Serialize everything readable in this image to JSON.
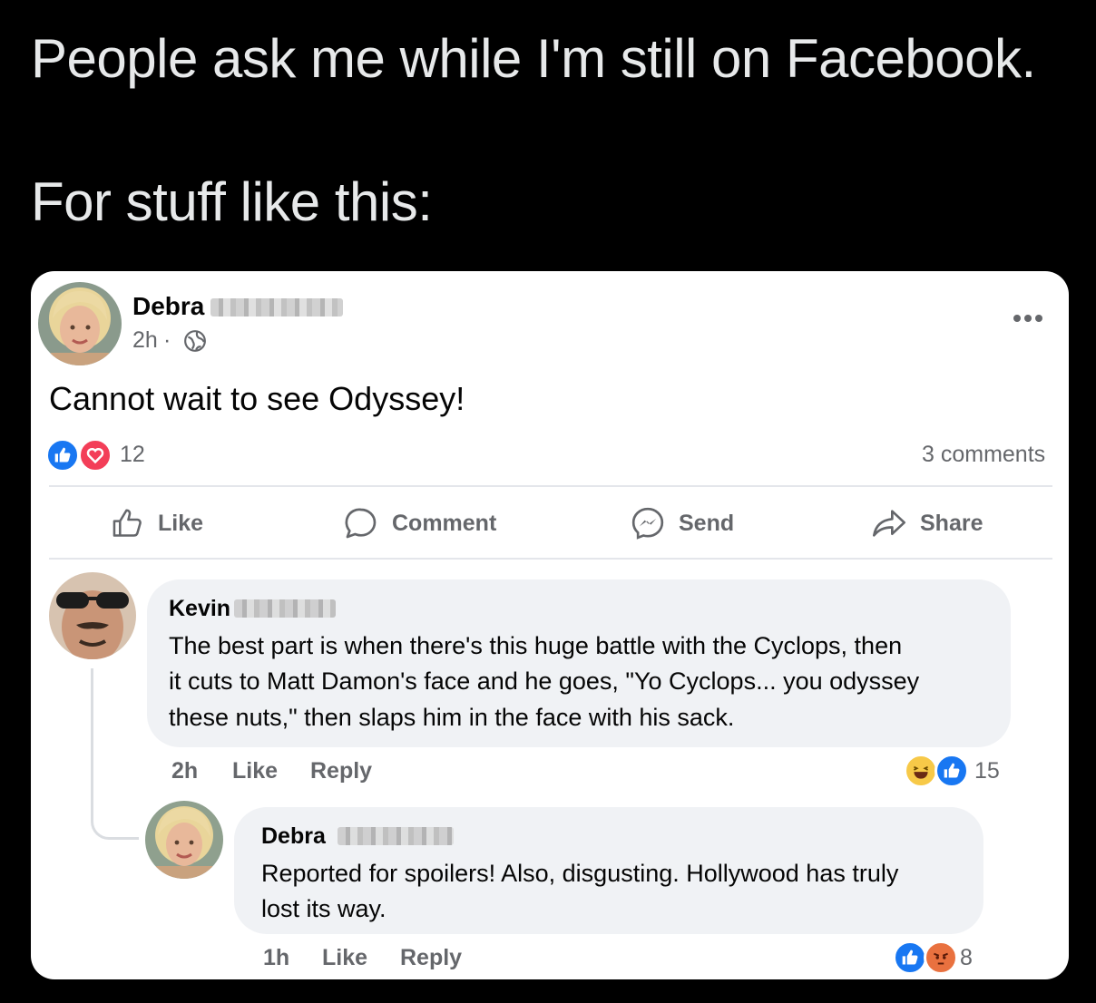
{
  "tweet": {
    "line1": "People ask me while I'm still on Facebook.",
    "line2": "For stuff like this:"
  },
  "post": {
    "author": "Debra",
    "time": "2h",
    "separator": "·",
    "text": "Cannot wait to see Odyssey!",
    "reaction_count": "12",
    "comments_count": "3 comments",
    "actions": {
      "like": "Like",
      "comment": "Comment",
      "send": "Send",
      "share": "Share"
    }
  },
  "comments": [
    {
      "author": "Kevin",
      "text_lines": [
        "The best part is when there's this huge battle with the Cyclops, then",
        "it cuts to Matt Damon's face and he goes, \"Yo Cyclops... you odyssey",
        "these nuts,\" then slaps him in the face with his sack."
      ],
      "time": "2h",
      "like": "Like",
      "reply": "Reply",
      "reaction_count": "15"
    },
    {
      "author": "Debra",
      "text_lines": [
        "Reported for spoilers! Also, disgusting. Hollywood has truly",
        "lost its way."
      ],
      "time": "1h",
      "like": "Like",
      "reply": "Reply",
      "reaction_count": "8"
    }
  ],
  "colors": {
    "like_blue": "#1877f2",
    "love_red": "#f33e58",
    "haha_yellow": "#f7c948",
    "angry_orange": "#e9713f",
    "text_muted": "#65676b",
    "bubble_bg": "#f0f2f5"
  }
}
